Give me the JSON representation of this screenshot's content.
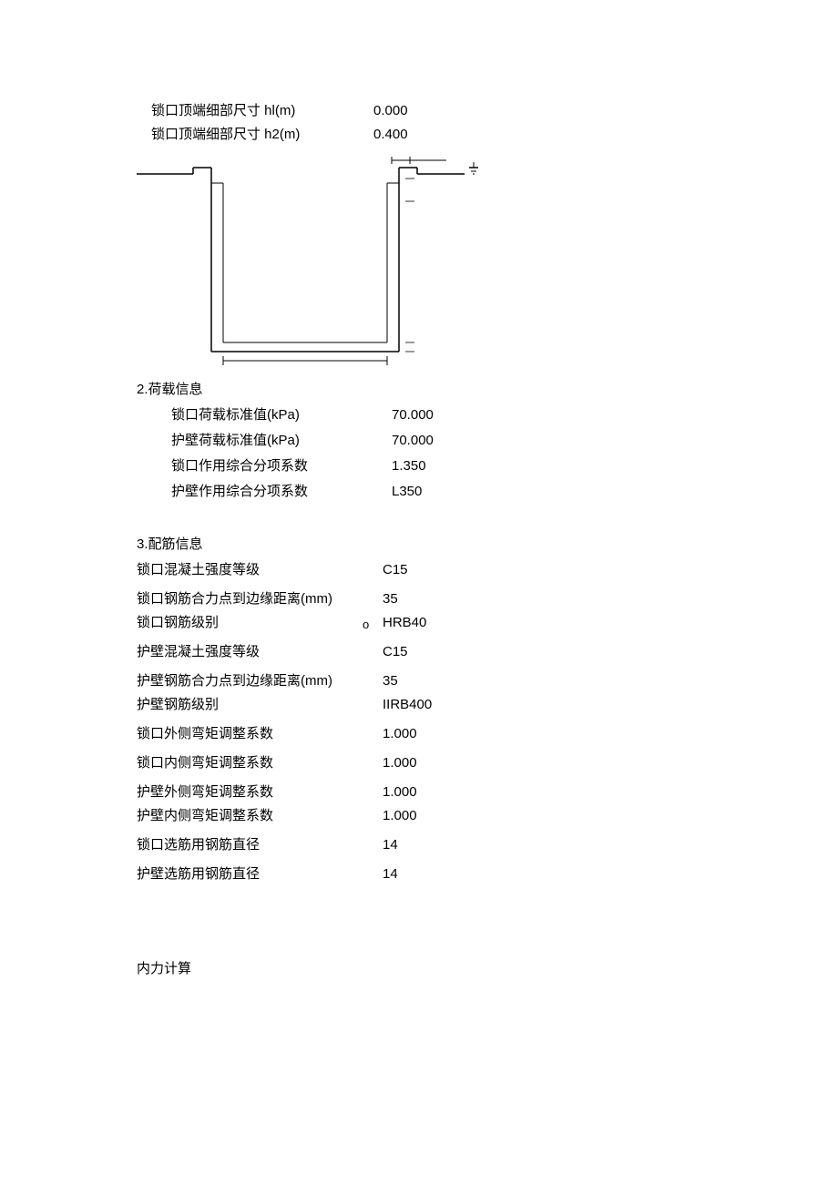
{
  "top": {
    "items": [
      {
        "label": "锁口顶端细部尺寸 hl(m)",
        "value": "0.000"
      },
      {
        "label": "锁口顶端细部尺寸 h2(m)",
        "value": "0.400"
      }
    ]
  },
  "chart_data": {
    "type": "diagram",
    "title": "U-shaped cross section",
    "annotations": []
  },
  "section2": {
    "title": "2.荷载信息",
    "items": [
      {
        "label": "锁口荷载标准值(kPa)",
        "value": "70.000"
      },
      {
        "label": "护壁荷载标准值(kPa)",
        "value": "70.000"
      },
      {
        "label": "锁口作用综合分项系数",
        "value": "1.350"
      },
      {
        "label": "护壁作用综合分项系数",
        "value": "L350"
      }
    ]
  },
  "section3": {
    "title": "3.配筋信息",
    "note_char": "ᴏ",
    "items": [
      {
        "label": "锁口混凝土强度等级",
        "value": "C15"
      },
      {
        "label": "锁口钢筋合力点到边缘距离(mm)",
        "value": "35"
      },
      {
        "label": "锁口钢筋级别",
        "value": "HRB40"
      },
      {
        "label": "护壁混凝土强度等级",
        "value": "C15"
      },
      {
        "label": "护壁钢筋合力点到边缘距离(mm)",
        "value": "35"
      },
      {
        "label": "护壁钢筋级别",
        "value": "IIRB400"
      },
      {
        "label": "锁口外侧弯矩调整系数",
        "value": "1.000"
      },
      {
        "label": "锁口内侧弯矩调整系数",
        "value": "1.000"
      },
      {
        "label": "护壁外侧弯矩调整系数",
        "value": "1.000"
      },
      {
        "label": "护壁内侧弯矩调整系数",
        "value": "1.000"
      },
      {
        "label": "锁口选筋用钢筋直径",
        "value": "14"
      },
      {
        "label": "护壁选筋用钢筋直径",
        "value": "14"
      }
    ]
  },
  "footer": {
    "title": "内力计算"
  }
}
